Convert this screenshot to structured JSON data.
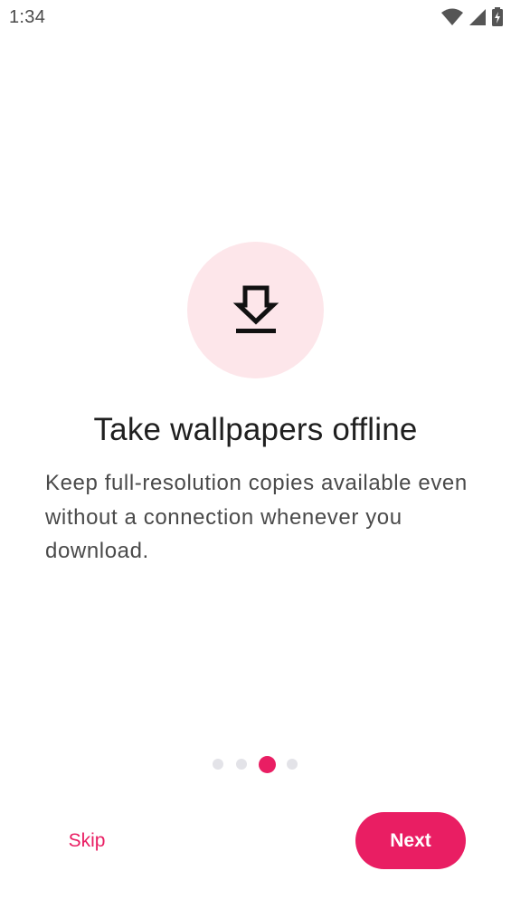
{
  "status_bar": {
    "time": "1:34",
    "icons": [
      "wifi-icon",
      "cellular-signal-icon",
      "battery-charging-icon"
    ]
  },
  "onboarding": {
    "icon": "download-icon",
    "title": "Take wallpapers offline",
    "description": "Keep full-resolution copies available even without a connection whenever you download.",
    "page_indicator": {
      "total": 4,
      "current": 3
    }
  },
  "actions": {
    "skip_label": "Skip",
    "next_label": "Next"
  },
  "colors": {
    "accent": "#e91e63",
    "icon_circle": "#fde6ea",
    "inactive_dot": "#e3e3e8",
    "title_text": "#1f1f1f",
    "body_text": "#4a4a4a"
  }
}
